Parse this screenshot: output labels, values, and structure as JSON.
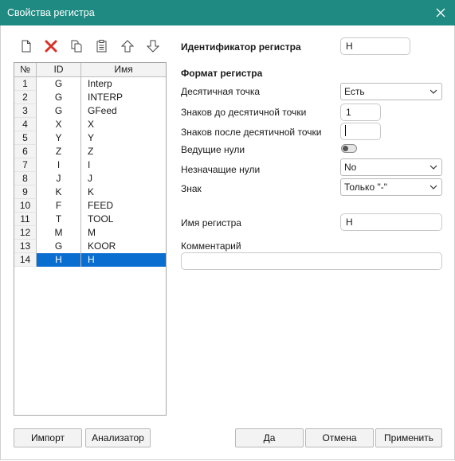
{
  "window": {
    "title": "Свойства регистра"
  },
  "toolbar": {
    "icons": [
      "new-document-icon",
      "delete-icon",
      "copy-icon",
      "paste-icon",
      "move-up-icon",
      "move-down-icon"
    ],
    "delete_color": "#d93025"
  },
  "grid": {
    "columns": [
      "№",
      "ID",
      "Имя"
    ],
    "rows": [
      {
        "num": "1",
        "id": "G",
        "name": "Interp"
      },
      {
        "num": "2",
        "id": "G",
        "name": "INTERP"
      },
      {
        "num": "3",
        "id": "G",
        "name": "GFeed"
      },
      {
        "num": "4",
        "id": "X",
        "name": "X"
      },
      {
        "num": "5",
        "id": "Y",
        "name": "Y"
      },
      {
        "num": "6",
        "id": "Z",
        "name": "Z"
      },
      {
        "num": "7",
        "id": "I",
        "name": "I"
      },
      {
        "num": "8",
        "id": "J",
        "name": "J"
      },
      {
        "num": "9",
        "id": "K",
        "name": "K"
      },
      {
        "num": "10",
        "id": "F",
        "name": "FEED"
      },
      {
        "num": "11",
        "id": "T",
        "name": "TOOL"
      },
      {
        "num": "12",
        "id": "M",
        "name": "M"
      },
      {
        "num": "13",
        "id": "G",
        "name": "KOOR"
      },
      {
        "num": "14",
        "id": "H",
        "name": "H"
      }
    ],
    "selected_row": "14",
    "selection_color": "#0a6ed1"
  },
  "form": {
    "id_label": "Идентификатор регистра",
    "id_value": "H",
    "format_header": "Формат регистра",
    "decimal_point_label": "Десятичная точка",
    "decimal_point_value": "Есть",
    "digits_before_label": "Знаков до десятичной точки",
    "digits_before_value": "1",
    "digits_after_label": "Знаков после десятичной точки",
    "digits_after_value": "",
    "leading_zeros_label": "Ведущие нули",
    "leading_zeros_on": false,
    "trailing_zeros_label": "Незначащие нули",
    "trailing_zeros_value": "No",
    "sign_label": "Знак",
    "sign_value": "Только \"-\"",
    "name_label": "Имя регистра",
    "name_value": "H",
    "comment_label": "Комментарий",
    "comment_value": ""
  },
  "buttons": {
    "import": "Импорт",
    "analyzer": "Анализатор",
    "ok": "Да",
    "cancel": "Отмена",
    "apply": "Применить"
  },
  "colors": {
    "titlebar": "#1e8a82"
  }
}
